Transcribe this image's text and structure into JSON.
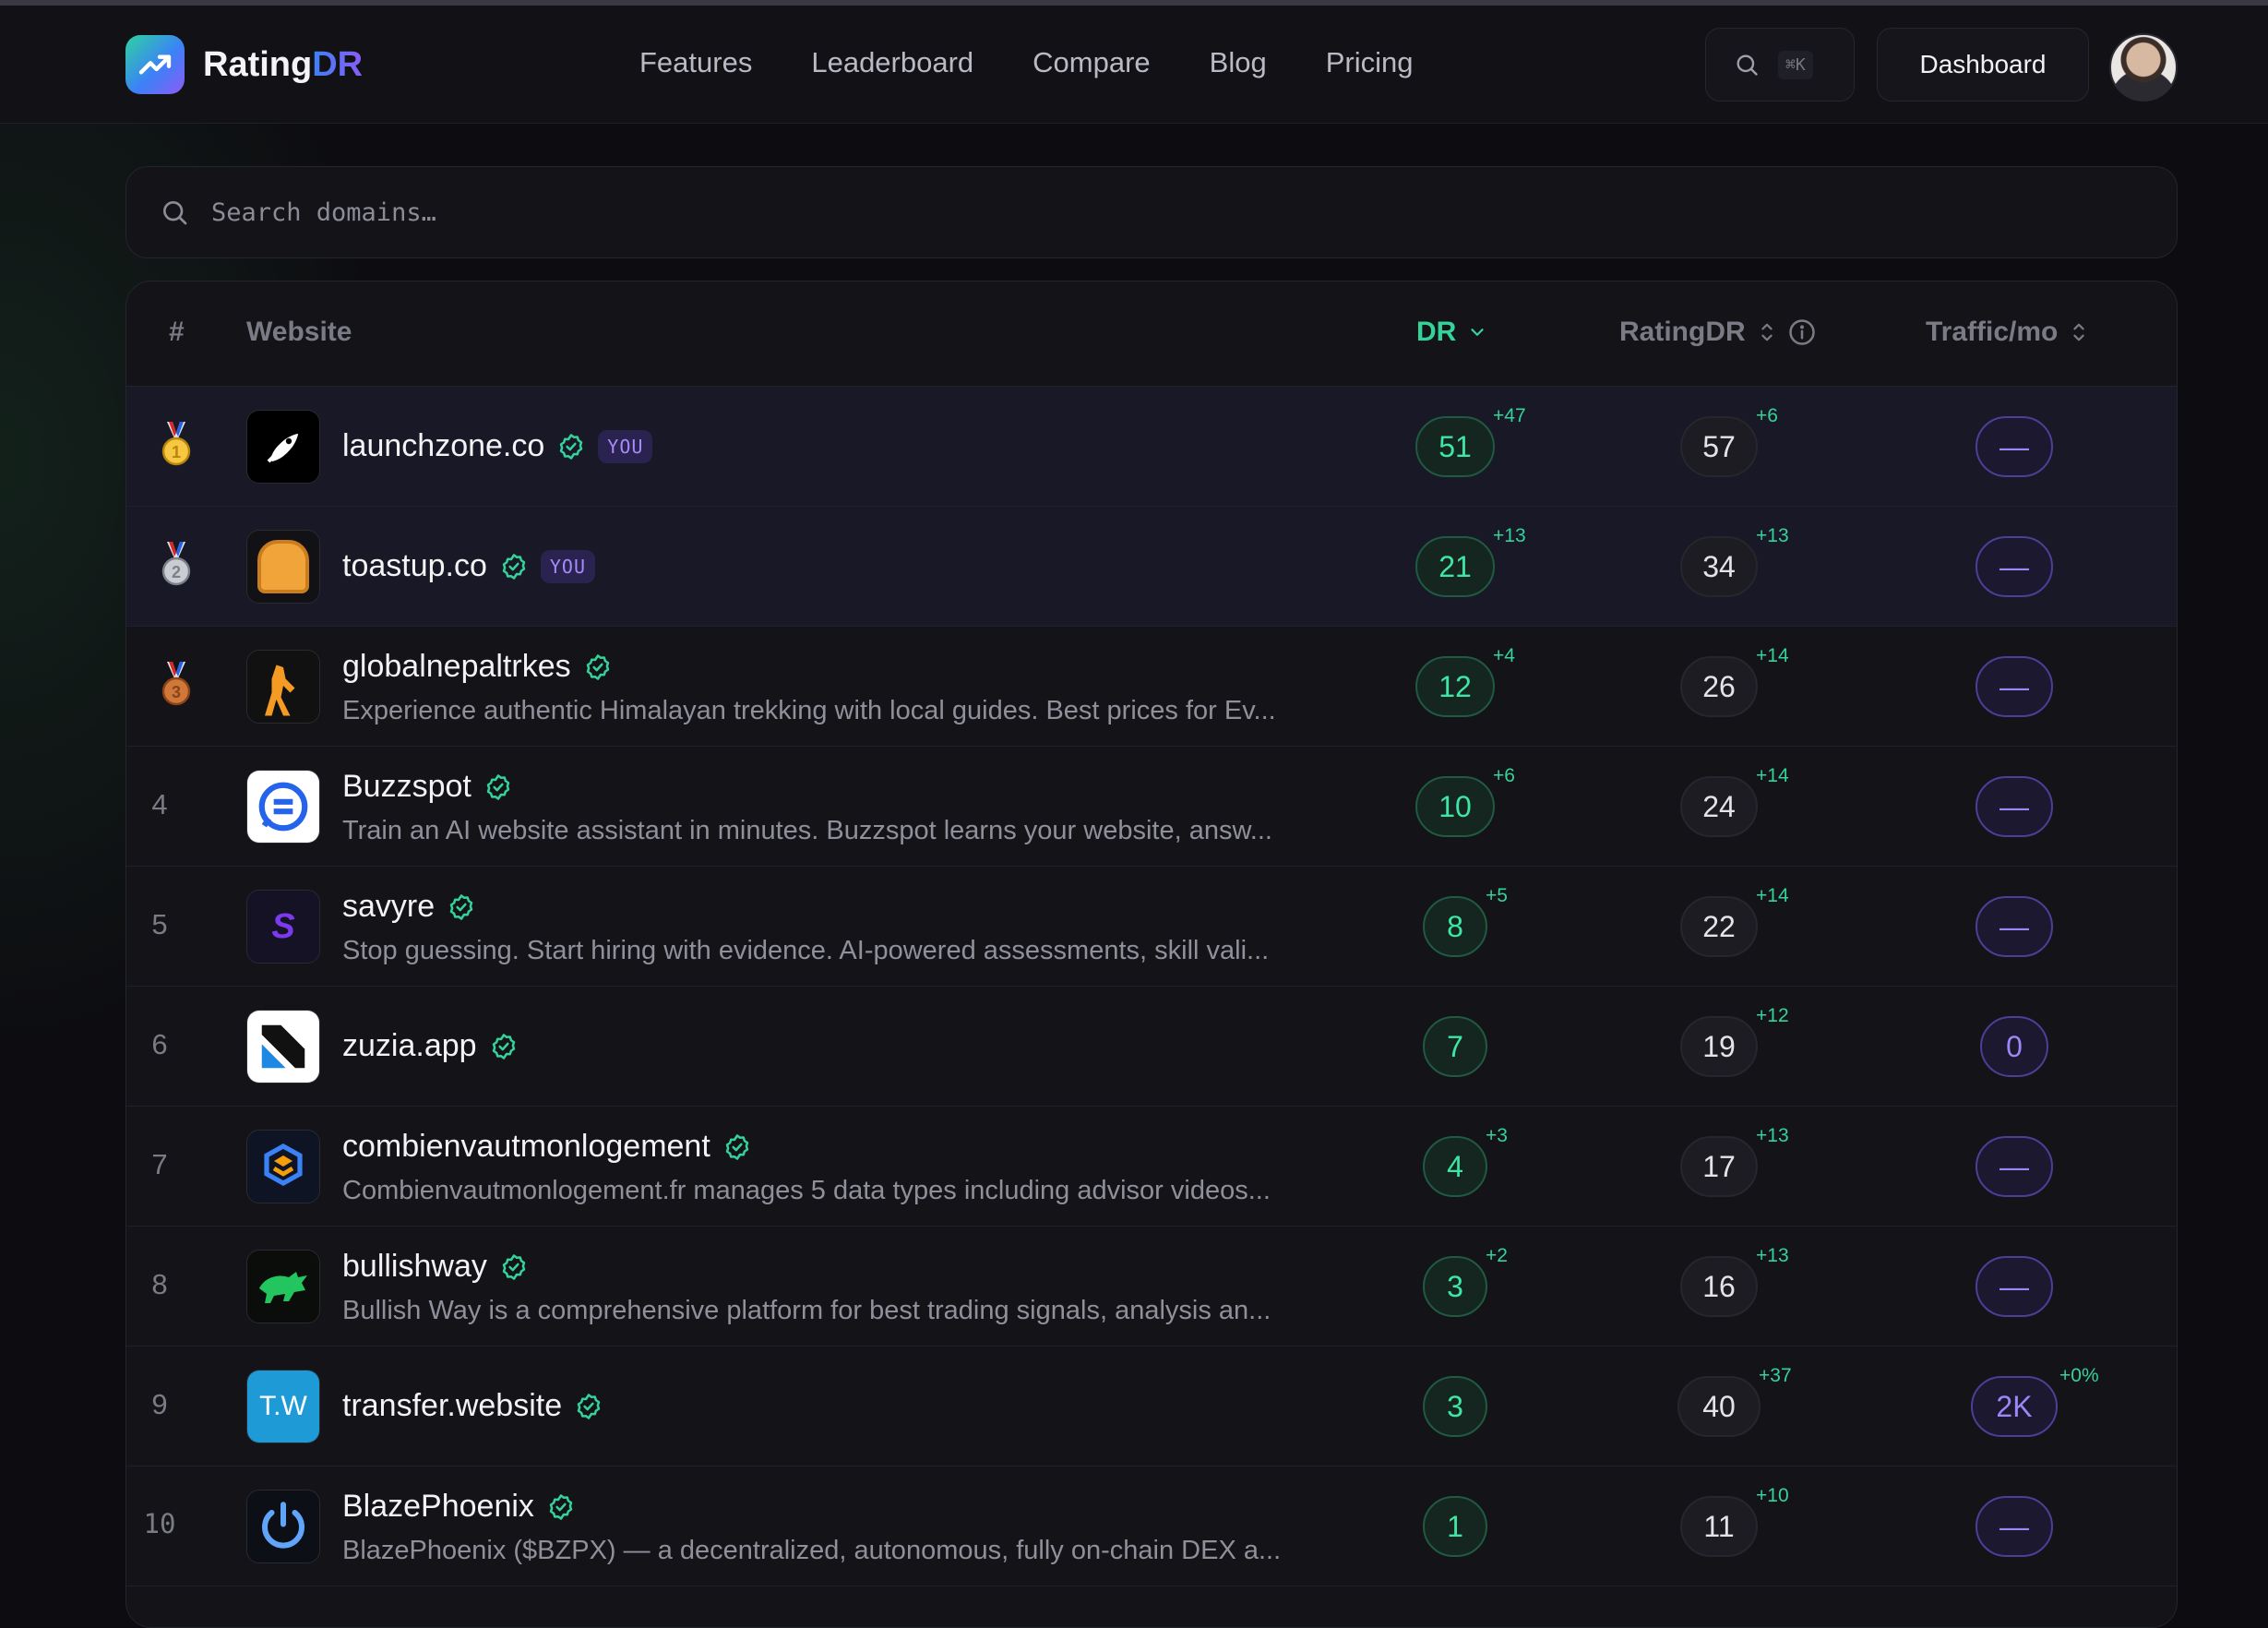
{
  "nav": {
    "brand_main": "Rating",
    "brand_accent": "DR",
    "menu": [
      "Features",
      "Leaderboard",
      "Compare",
      "Blog",
      "Pricing"
    ],
    "search_shortcut": "⌘K",
    "dashboard_label": "Dashboard"
  },
  "search": {
    "placeholder": "Search domains…"
  },
  "table": {
    "headers": {
      "rank": "#",
      "website": "Website",
      "dr": "DR",
      "ratingdr": "RatingDR",
      "traffic": "Traffic/mo"
    },
    "rows": [
      {
        "rank": "1",
        "medal": "gold",
        "name": "launchzone.co",
        "you": "YOU",
        "desc": "",
        "dr": "51",
        "dr_delta": "+47",
        "rdr": "57",
        "rdr_delta": "+6",
        "traffic": "—",
        "traffic_delta": ""
      },
      {
        "rank": "2",
        "medal": "silver",
        "name": "toastup.co",
        "you": "YOU",
        "desc": "",
        "dr": "21",
        "dr_delta": "+13",
        "rdr": "34",
        "rdr_delta": "+13",
        "traffic": "—",
        "traffic_delta": ""
      },
      {
        "rank": "3",
        "medal": "bronze",
        "name": "globalnepaltrkes",
        "you": "",
        "desc": "Experience authentic Himalayan trekking with local guides. Best prices for Ev...",
        "dr": "12",
        "dr_delta": "+4",
        "rdr": "26",
        "rdr_delta": "+14",
        "traffic": "—",
        "traffic_delta": ""
      },
      {
        "rank": "4",
        "medal": "",
        "name": "Buzzspot",
        "you": "",
        "desc": "Train an AI website assistant in minutes. Buzzspot learns your website, answ...",
        "dr": "10",
        "dr_delta": "+6",
        "rdr": "24",
        "rdr_delta": "+14",
        "traffic": "—",
        "traffic_delta": ""
      },
      {
        "rank": "5",
        "medal": "",
        "name": "savyre",
        "you": "",
        "desc": "Stop guessing. Start hiring with evidence. AI-powered assessments, skill vali...",
        "dr": "8",
        "dr_delta": "+5",
        "rdr": "22",
        "rdr_delta": "+14",
        "traffic": "—",
        "traffic_delta": ""
      },
      {
        "rank": "6",
        "medal": "",
        "name": "zuzia.app",
        "you": "",
        "desc": "",
        "dr": "7",
        "dr_delta": "",
        "rdr": "19",
        "rdr_delta": "+12",
        "traffic": "0",
        "traffic_delta": ""
      },
      {
        "rank": "7",
        "medal": "",
        "name": "combienvautmonlogement",
        "you": "",
        "desc": "Combienvautmonlogement.fr manages 5 data types including advisor videos...",
        "dr": "4",
        "dr_delta": "+3",
        "rdr": "17",
        "rdr_delta": "+13",
        "traffic": "—",
        "traffic_delta": ""
      },
      {
        "rank": "8",
        "medal": "",
        "name": "bullishway",
        "you": "",
        "desc": "Bullish Way is a comprehensive platform for best trading signals, analysis an...",
        "dr": "3",
        "dr_delta": "+2",
        "rdr": "16",
        "rdr_delta": "+13",
        "traffic": "—",
        "traffic_delta": ""
      },
      {
        "rank": "9",
        "medal": "",
        "name": "transfer.website",
        "you": "",
        "desc": "",
        "dr": "3",
        "dr_delta": "",
        "rdr": "40",
        "rdr_delta": "+37",
        "traffic": "2K",
        "traffic_delta": "+0%"
      },
      {
        "rank": "10",
        "medal": "",
        "name": "BlazePhoenix",
        "you": "",
        "desc": "BlazePhoenix ($BZPX) — a decentralized, autonomous, fully on-chain DEX a...",
        "dr": "1",
        "dr_delta": "",
        "rdr": "11",
        "rdr_delta": "+10",
        "traffic": "—",
        "traffic_delta": ""
      }
    ],
    "icons": [
      "rocket-icon",
      "toast-icon",
      "trekker-icon",
      "chat-bubble-icon",
      "savyre-logo-icon",
      "zuzia-logo-icon",
      "cube-logo-icon",
      "bull-icon",
      "tw-logo-icon",
      "power-icon"
    ]
  },
  "colors": {
    "accent_green": "#34d399",
    "accent_purple": "#8b5cf6",
    "background": "#0d0d11"
  }
}
